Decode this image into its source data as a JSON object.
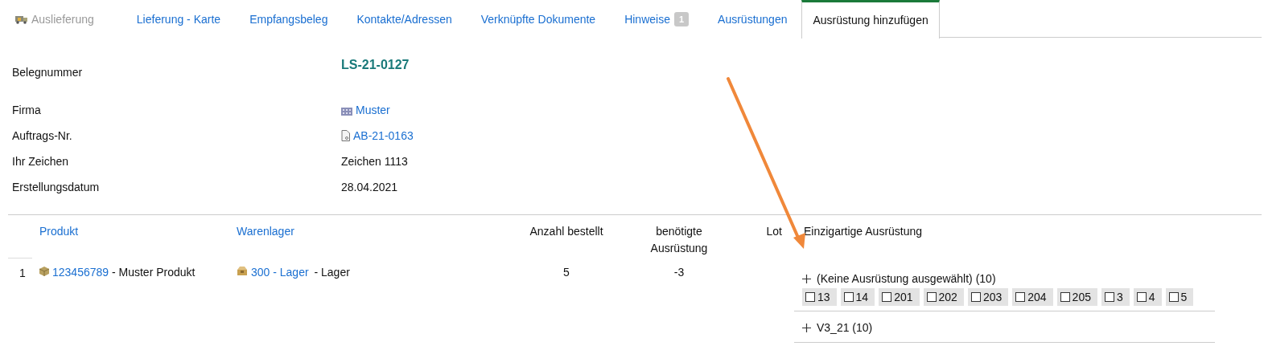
{
  "tabs": [
    {
      "label": "Auslieferung",
      "kind": "icon",
      "disabled": true,
      "selected": false
    },
    {
      "label": "Lieferung - Karte",
      "kind": "plain",
      "disabled": false,
      "selected": false
    },
    {
      "label": "Empfangsbeleg",
      "kind": "plain",
      "disabled": false,
      "selected": false
    },
    {
      "label": "Kontakte/Adressen",
      "kind": "plain",
      "disabled": false,
      "selected": false
    },
    {
      "label": "Verknüpfte Dokumente",
      "kind": "plain",
      "disabled": false,
      "selected": false
    },
    {
      "label": "Hinweise",
      "kind": "plain",
      "badge": "1",
      "disabled": false,
      "selected": false
    },
    {
      "label": "Ausrüstungen",
      "kind": "plain",
      "disabled": false,
      "selected": false
    },
    {
      "label": "Ausrüstung hinzufügen",
      "kind": "plain",
      "disabled": false,
      "selected": true
    }
  ],
  "details": [
    {
      "label": "Belegnummer",
      "value": "LS-21-0127",
      "kind": "heading"
    },
    {
      "label": "Firma",
      "value": "Muster",
      "kind": "company-link"
    },
    {
      "label": "Auftrags-Nr.",
      "value": "AB-21-0163",
      "kind": "document-link"
    },
    {
      "label": "Ihr Zeichen",
      "value": "Zeichen 1113",
      "kind": "text"
    },
    {
      "label": "Erstellungsdatum",
      "value": "28.04.2021",
      "kind": "text"
    }
  ],
  "table": {
    "columns": [
      {
        "label": "Produkt",
        "kind": "link"
      },
      {
        "label": "Warenlager",
        "kind": "link"
      },
      {
        "label": "Anzahl bestellt",
        "kind": "text"
      },
      {
        "label": "benötigte Ausrüstung",
        "kind": "text"
      },
      {
        "label": "Lot",
        "kind": "text"
      },
      {
        "label": "Einzigartige Ausrüstung",
        "kind": "text"
      }
    ],
    "rows": [
      {
        "index": "1",
        "product_code": "123456789",
        "product_name": "- Muster Produkt",
        "warehouse_code": "300 - Lager",
        "warehouse_name": "- Lager",
        "ordered": "5",
        "required": "-3",
        "equipment_groups": [
          {
            "title": "(Keine Ausrüstung ausgewählt) (10)",
            "items": [
              {
                "label": "13",
                "checked": false
              },
              {
                "label": "14",
                "checked": false
              },
              {
                "label": "201",
                "checked": false
              },
              {
                "label": "202",
                "checked": false
              },
              {
                "label": "203",
                "checked": false
              },
              {
                "label": "204",
                "checked": false
              },
              {
                "label": "205",
                "checked": false
              },
              {
                "label": "3",
                "checked": false
              },
              {
                "label": "4",
                "checked": false
              },
              {
                "label": "5",
                "checked": false
              }
            ]
          },
          {
            "title": "V3_21 (10)"
          }
        ]
      }
    ]
  }
}
